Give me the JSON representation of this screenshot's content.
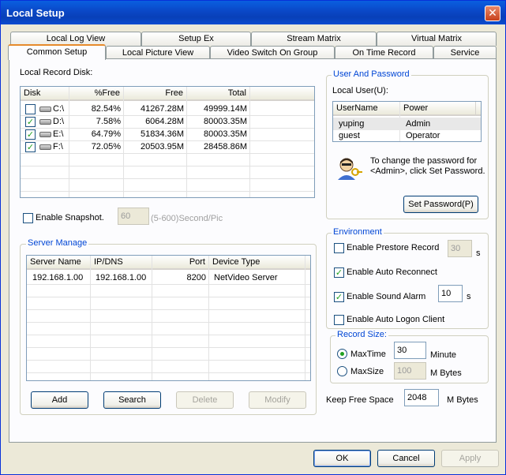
{
  "window": {
    "title": "Local Setup",
    "close_glyph": "✕"
  },
  "tabs": {
    "row1": [
      "Local Log View",
      "Setup Ex",
      "Stream Matrix",
      "Virtual Matrix"
    ],
    "row2": [
      "Common Setup",
      "Local Picture View",
      "Video Switch On Group",
      "On Time Record",
      "Service"
    ],
    "active": "Common Setup"
  },
  "record_disk": {
    "label": "Local Record Disk:",
    "columns": [
      "Disk",
      "%Free",
      "Free",
      "Total"
    ],
    "rows": [
      {
        "checked": false,
        "disk": "C:\\",
        "pct_free": "82.54%",
        "free": "41267.28M",
        "total": "49999.14M"
      },
      {
        "checked": true,
        "disk": "D:\\",
        "pct_free": "7.58%",
        "free": "6064.28M",
        "total": "80003.35M"
      },
      {
        "checked": true,
        "disk": "E:\\",
        "pct_free": "64.79%",
        "free": "51834.36M",
        "total": "80003.35M"
      },
      {
        "checked": true,
        "disk": "F:\\",
        "pct_free": "72.05%",
        "free": "20503.95M",
        "total": "28458.86M"
      }
    ]
  },
  "snapshot": {
    "label": "Enable Snapshot.",
    "value": "60",
    "hint": "(5-600)Second/Pic"
  },
  "server_manage": {
    "title": "Server Manage",
    "columns": [
      "Server Name",
      "IP/DNS",
      "Port",
      "Device Type"
    ],
    "rows": [
      {
        "name": "192.168.1.00",
        "ip": "192.168.1.00",
        "port": "8200",
        "type": "NetVideo Server"
      }
    ],
    "buttons": {
      "add": "Add",
      "search": "Search",
      "delete": "Delete",
      "modify": "Modify"
    }
  },
  "user_password": {
    "title": "User And Password",
    "local_user_label": "Local User(U):",
    "columns": [
      "UserName",
      "Power"
    ],
    "rows": [
      {
        "user": "yuping",
        "power": "Admin"
      },
      {
        "user": "guest",
        "power": "Operator"
      }
    ],
    "info_text": "To change the password for <Admin>, click Set Password.",
    "set_password": "Set Password(P)"
  },
  "environment": {
    "title": "Environment",
    "prestore": {
      "label": "Enable Prestore Record",
      "value": "30",
      "unit": "s",
      "checked": false
    },
    "auto_reconnect": {
      "label": "Enable Auto Reconnect",
      "checked": true
    },
    "sound_alarm": {
      "label": "Enable Sound Alarm",
      "value": "10",
      "unit": "s",
      "checked": true
    },
    "auto_logon": {
      "label": "Enable Auto Logon Client",
      "checked": false
    }
  },
  "record_size": {
    "title": "Record Size:",
    "maxtime": {
      "label": "MaxTime",
      "value": "30",
      "unit": "Minute"
    },
    "maxsize": {
      "label": "MaxSize",
      "value": "100",
      "unit": "M Bytes"
    }
  },
  "keep_free": {
    "label": "Keep Free Space",
    "value": "2048",
    "unit": "M Bytes"
  },
  "footer": {
    "ok": "OK",
    "cancel": "Cancel",
    "apply": "Apply"
  },
  "colors": {
    "title_bar": "#0a47c6",
    "group_title": "#0046d5",
    "check": "#21a121"
  },
  "icons": {
    "user_icon": "user-key-icon",
    "disk_icon": "hard-disk-icon"
  }
}
